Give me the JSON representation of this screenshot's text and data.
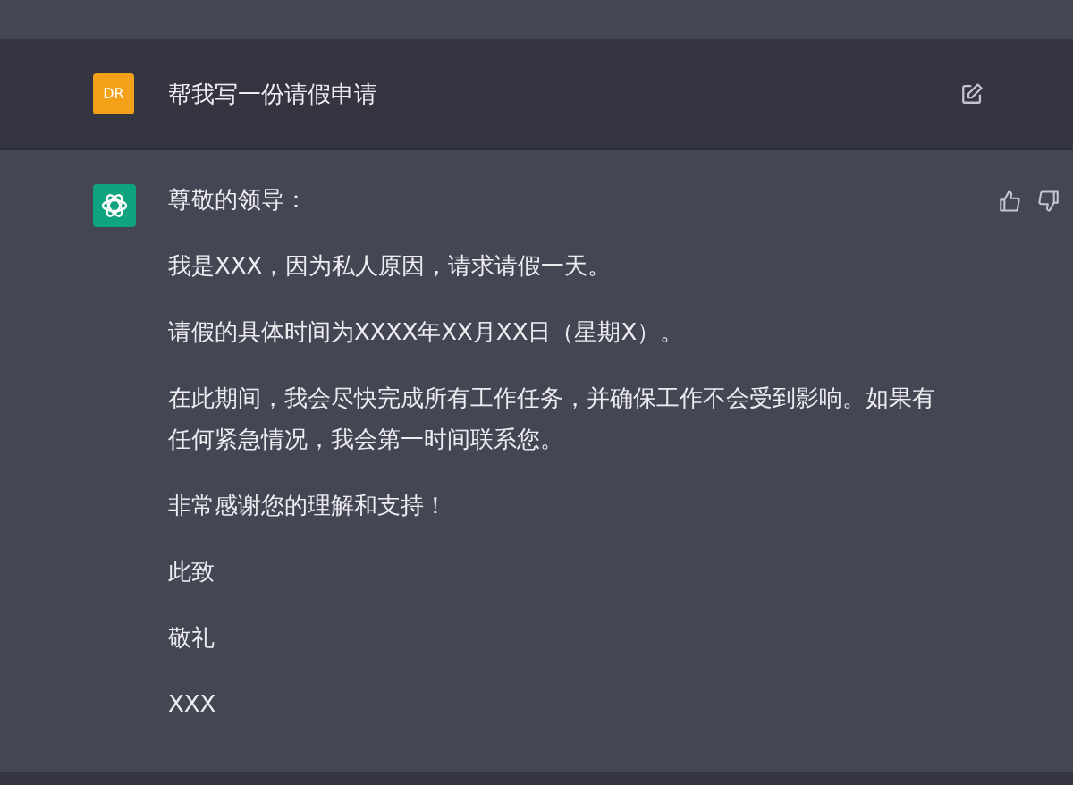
{
  "user_message": {
    "avatar": "DR",
    "text": "帮我写一份请假申请"
  },
  "assistant_message": {
    "paragraphs": [
      "尊敬的领导：",
      "我是XXX，因为私人原因，请求请假一天。",
      "请假的具体时间为XXXX年XX月XX日（星期X）。",
      "在此期间，我会尽快完成所有工作任务，并确保工作不会受到影响。如果有任何紧急情况，我会第一时间联系您。",
      "非常感谢您的理解和支持！",
      "此致",
      "敬礼",
      "XXX"
    ]
  }
}
